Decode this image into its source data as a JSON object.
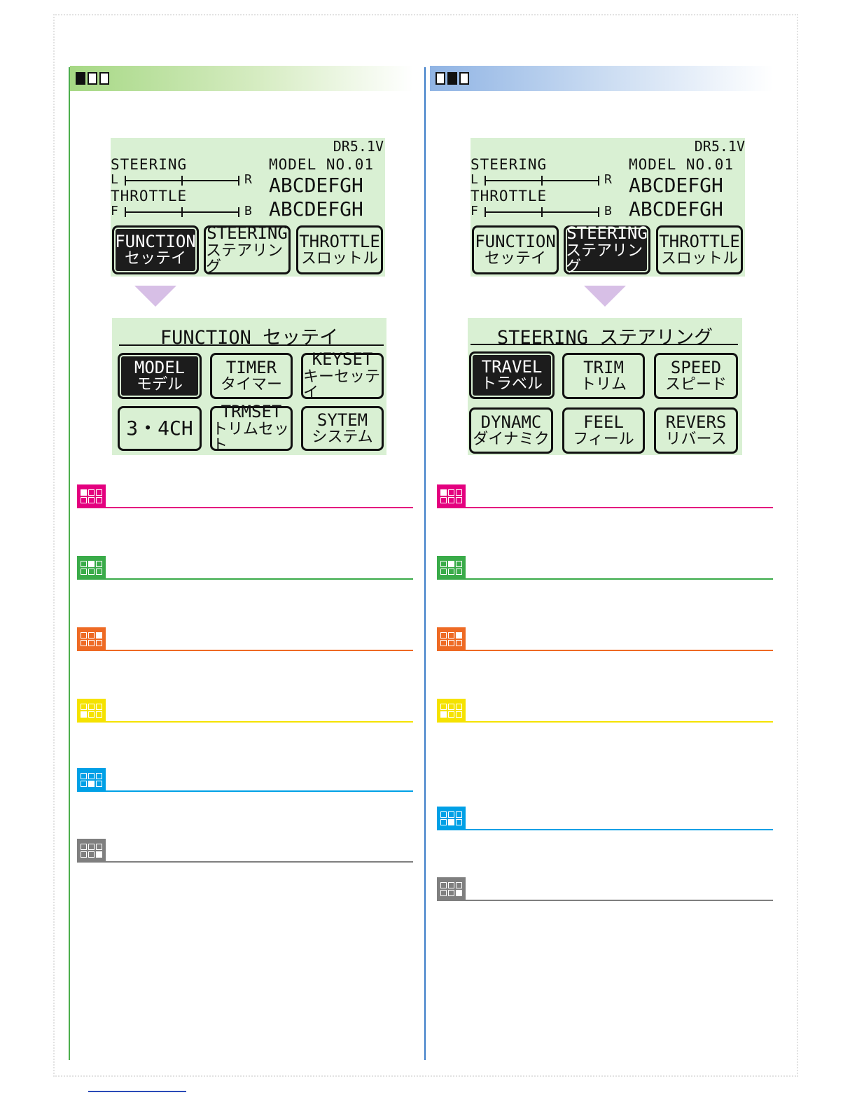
{
  "left_panel": {
    "header_indicator": [
      true,
      false,
      false
    ],
    "color": "#4cae4c",
    "main_screen": {
      "version": "DR5.1V",
      "steering_label": "STEERING",
      "steering_left": "L",
      "steering_right": "R",
      "throttle_label": "THROTTLE",
      "throttle_left": "F",
      "throttle_right": "B",
      "model_no": "MODEL NO.01",
      "name1": "ABCDEFGH",
      "name2": "ABCDEFGH",
      "buttons": [
        {
          "en": "FUNCTION",
          "jp": "セッテイ",
          "selected": true
        },
        {
          "en": "STEERING",
          "jp": "ステアリング",
          "selected": false
        },
        {
          "en": "THROTTLE",
          "jp": "スロットル",
          "selected": false
        }
      ]
    },
    "sub_screen": {
      "title": "FUNCTION  セッテイ",
      "buttons": [
        {
          "en": "MODEL",
          "jp": "モデル",
          "selected": true
        },
        {
          "en": "TIMER",
          "jp": "タイマー",
          "selected": false
        },
        {
          "en": "KEYSET",
          "jp": "キーセッテイ",
          "selected": false
        },
        {
          "en": "3・4CH",
          "jp": "",
          "selected": false
        },
        {
          "en": "TRMSET",
          "jp": "トリムセット",
          "selected": false
        },
        {
          "en": "SYTEM",
          "jp": "システム",
          "selected": false
        }
      ]
    },
    "markers": [
      {
        "color": "#e4007f",
        "active": 0
      },
      {
        "color": "#3aab49",
        "active": 1
      },
      {
        "color": "#ee6a24",
        "active": 2
      },
      {
        "color": "#f5e200",
        "active": 3
      },
      {
        "color": "#00a0e6",
        "active": 4
      },
      {
        "color": "#7f7f7f",
        "active": 5
      }
    ]
  },
  "right_panel": {
    "header_indicator": [
      false,
      true,
      false
    ],
    "color": "#3d7dc8",
    "main_screen": {
      "version": "DR5.1V",
      "steering_label": "STEERING",
      "steering_left": "L",
      "steering_right": "R",
      "throttle_label": "THROTTLE",
      "throttle_left": "F",
      "throttle_right": "B",
      "model_no": "MODEL NO.01",
      "name1": "ABCDEFGH",
      "name2": "ABCDEFGH",
      "buttons": [
        {
          "en": "FUNCTION",
          "jp": "セッテイ",
          "selected": false
        },
        {
          "en": "STEERING",
          "jp": "ステアリング",
          "selected": true
        },
        {
          "en": "THROTTLE",
          "jp": "スロットル",
          "selected": false
        }
      ]
    },
    "sub_screen": {
      "title": "STEERING  ステアリング",
      "buttons": [
        {
          "en": "TRAVEL",
          "jp": "トラベル",
          "selected": true
        },
        {
          "en": "TRIM",
          "jp": "トリム",
          "selected": false
        },
        {
          "en": "SPEED",
          "jp": "スピード",
          "selected": false
        },
        {
          "en": "DYNAMC",
          "jp": "ダイナミク",
          "selected": false
        },
        {
          "en": "FEEL",
          "jp": "フィール",
          "selected": false
        },
        {
          "en": "REVERS",
          "jp": "リバース",
          "selected": false
        }
      ]
    },
    "markers": [
      {
        "color": "#e4007f",
        "active": 0
      },
      {
        "color": "#3aab49",
        "active": 1
      },
      {
        "color": "#ee6a24",
        "active": 2
      },
      {
        "color": "#f5e200",
        "active": 3
      },
      {
        "color": "#00a0e6",
        "active": 4
      },
      {
        "color": "#7f7f7f",
        "active": 5
      }
    ]
  }
}
